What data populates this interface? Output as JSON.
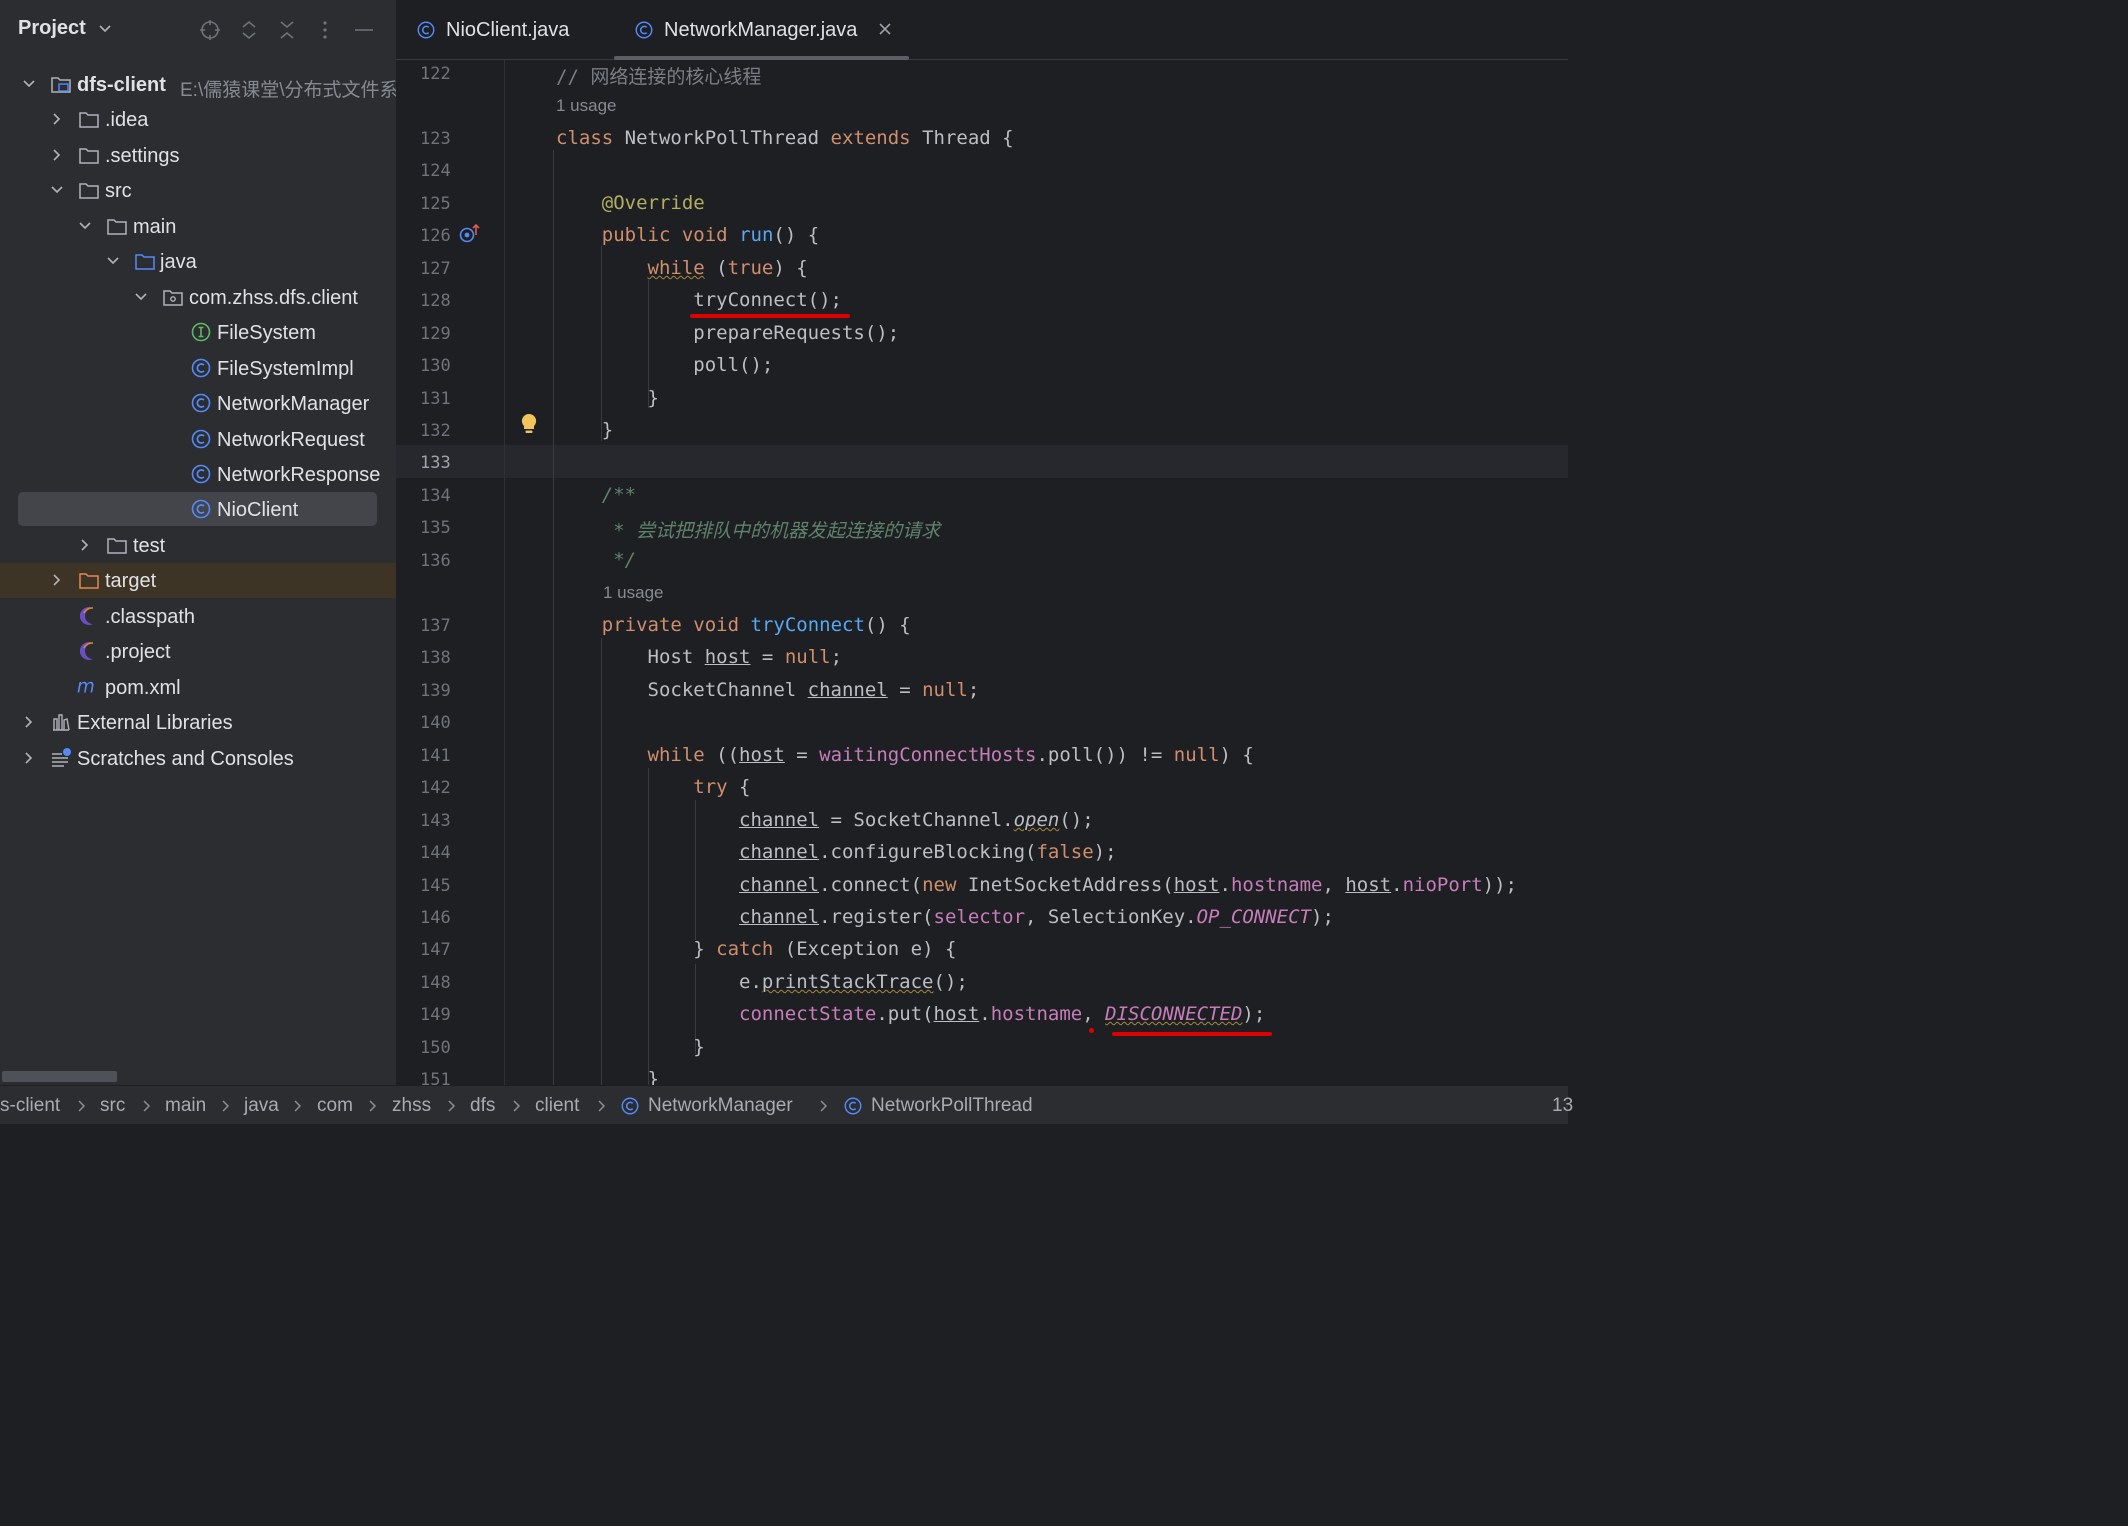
{
  "sidebar": {
    "title": "Project",
    "tree": {
      "root": {
        "label": "dfs-client",
        "path": "E:\\儒猿课堂\\分布式文件系"
      },
      "idea": ".idea",
      "settings": ".settings",
      "src": "src",
      "main": "main",
      "java": "java",
      "package": "com.zhss.dfs.client",
      "files": [
        "FileSystem",
        "FileSystemImpl",
        "NetworkManager",
        "NetworkRequest",
        "NetworkResponse",
        "NioClient"
      ],
      "test": "test",
      "target": "target",
      "classpath": ".classpath",
      "project": ".project",
      "pom": "pom.xml",
      "external_libraries": "External Libraries",
      "scratches": "Scratches and Consoles"
    }
  },
  "tabs": [
    {
      "label": "NioClient.java"
    },
    {
      "label": "NetworkManager.java"
    }
  ],
  "editor": {
    "usage_label": "1 usage",
    "line_numbers": [
      "122",
      "123",
      "124",
      "125",
      "126",
      "127",
      "128",
      "129",
      "130",
      "131",
      "132",
      "133",
      "134",
      "135",
      "136",
      "137",
      "138",
      "139",
      "140",
      "141",
      "142",
      "143",
      "144",
      "145",
      "146",
      "147",
      "148",
      "149",
      "150",
      "151"
    ],
    "current_line": "133",
    "comment_122_mark": "//",
    "comment_122_text": "网络连接的核心线程",
    "doc_open": "/**",
    "doc_line": "* 尝试把排队中的机器发起连接的请求",
    "doc_close": "*/"
  },
  "breadcrumb": [
    "s-client",
    "src",
    "main",
    "java",
    "com",
    "zhss",
    "dfs",
    "client",
    "NetworkManager",
    "NetworkPollThread"
  ],
  "status_right": "13",
  "colors": {
    "keyword": "#cf8e6d",
    "function": "#56a8f5",
    "annotation": "#b3ae60",
    "field": "#c77dbb",
    "doc_comment": "#5f826b",
    "class_icon": "#548af7",
    "interface_icon": "#5fb865",
    "highlight_mark": "#e00000"
  }
}
